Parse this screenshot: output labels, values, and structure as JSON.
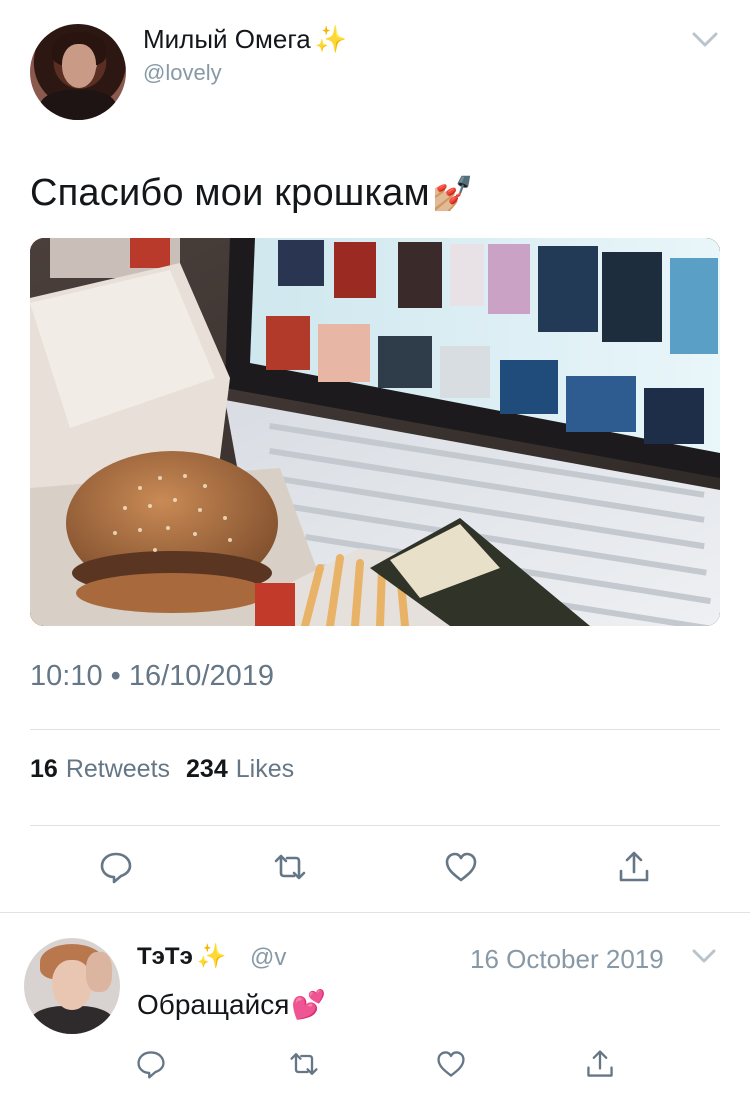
{
  "tweet": {
    "author_name": "Милый Омега",
    "author_emoji": "✨",
    "author_handle": "@lovely",
    "text": "Спасибо мои крошкам",
    "text_emoji": "💅🏼",
    "timestamp": "10:10 • 16/10/2019",
    "retweets_count": "16",
    "retweets_label": "Retweets",
    "likes_count": "234",
    "likes_label": "Likes",
    "icons": {
      "reply": "reply-icon",
      "retweet": "retweet-icon",
      "like": "heart-icon",
      "share": "share-icon",
      "more": "chevron-down-icon"
    }
  },
  "reply": {
    "author_name": "ТэТэ",
    "author_emoji": "✨",
    "author_handle": "@v",
    "date": "16 October 2019",
    "text": "Обращайся",
    "text_emoji": "💕"
  },
  "colors": {
    "text_primary": "#14171a",
    "text_secondary": "#657786",
    "handle_gray": "#8899a6",
    "divider": "#dde3e8"
  }
}
